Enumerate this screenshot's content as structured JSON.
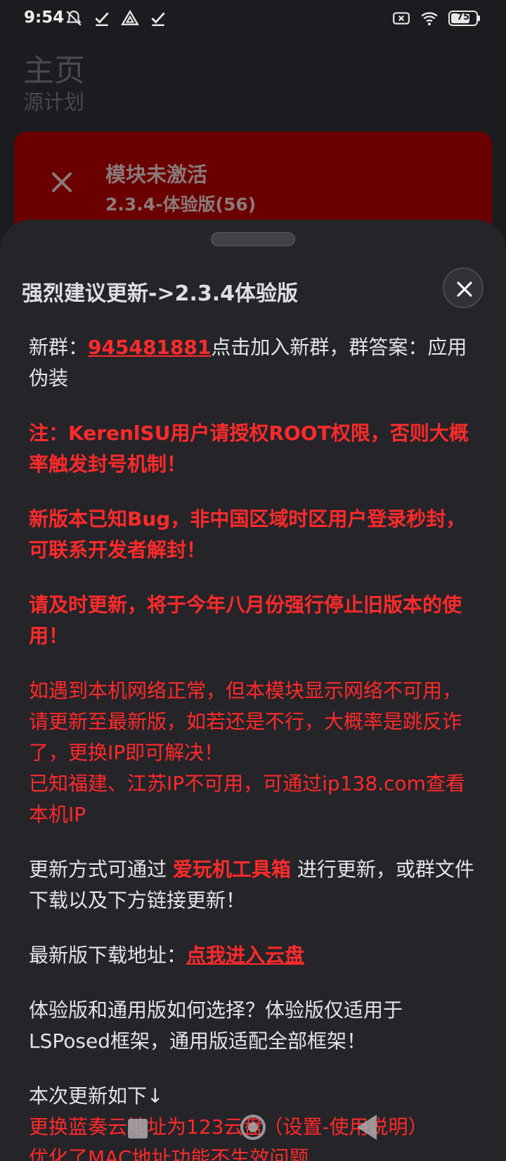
{
  "status_bar": {
    "time": "9:54",
    "battery": "75",
    "icons_left": [
      "notifications-off-icon",
      "check-icon",
      "delta-icon",
      "check-icon"
    ],
    "icons_right": [
      "sim-off-icon",
      "wifi-icon",
      "battery-icon"
    ]
  },
  "header": {
    "title": "主页",
    "subtitle": "源计划"
  },
  "module_card": {
    "title": "模块未激活",
    "version": "2.3.4-体验版(56)",
    "color": "#6b0000"
  },
  "dialog": {
    "title": "强烈建议更新->2.3.4体验版",
    "group_prefix": "新群：",
    "group_number": "945481881",
    "group_suffix": "点击加入新群，群答案：应用伪装",
    "note_root": "注：KerenlSU用户请授权ROOT权限，否则大概率触发封号机制！",
    "note_bug": "新版本已知Bug，非中国区域时区用户登录秒封，可联系开发者解封！",
    "note_update": "请及时更新，将于今年八月份强行停止旧版本的使用！",
    "network_line1": "如遇到本机网络正常，但本模块显示网络不可用，请更新至最新版，如若还是不行，大概率是跳反诈了，更换IP即可解决！",
    "network_line2": "已知福建、江苏IP不可用，可通过ip138.com查看本机IP",
    "update_prefix": "更新方式可通过 ",
    "update_tool": "爱玩机工具箱",
    "update_suffix": " 进行更新，或群文件下载以及下方链接更新！",
    "download_prefix": "最新版下载地址：",
    "download_link": "点我进入云盘",
    "choose_text": "体验版和通用版如何选择？体验版仅适用于LSPosed框架，通用版适配全部框架！",
    "changelog_title": "本次更新如下↓",
    "changelog_item1": "更换蓝奏云地址为123云盘（设置-使用说明）",
    "changelog_item2": "优化了MAC地址功能不生效问题"
  },
  "colors": {
    "background": "#1c1b1f",
    "sheet": "#252429",
    "warning_red": "#ff2a2a"
  }
}
